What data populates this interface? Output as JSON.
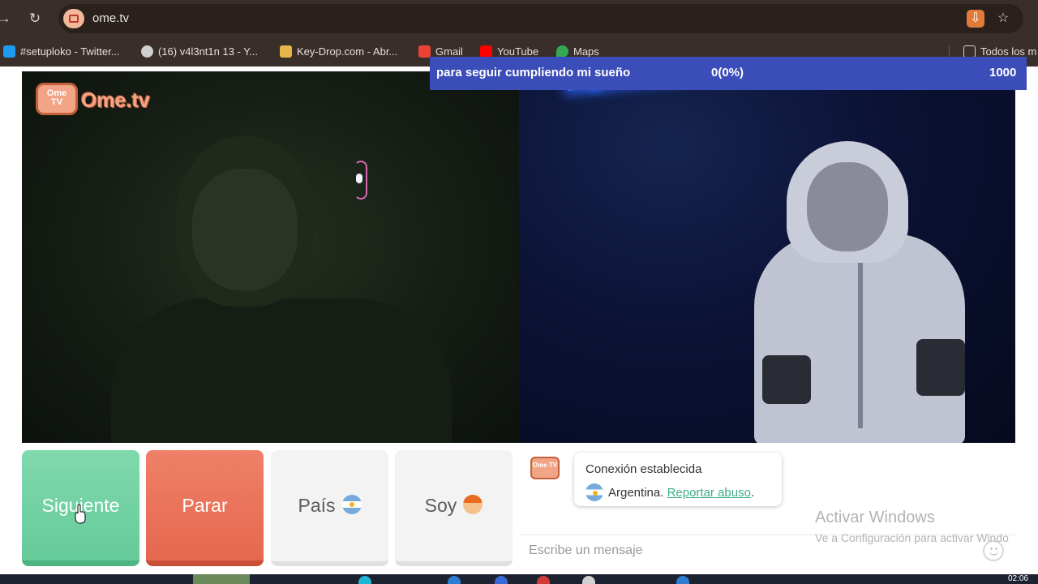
{
  "browser": {
    "url": "ome.tv",
    "nav_forward_icon": "arrow-right-icon",
    "reload_icon": "reload-icon",
    "site_icon": "video-camera-icon",
    "install_icon": "install-app-icon",
    "bookmark_star_icon": "star-icon"
  },
  "bookmarks": [
    {
      "label": "#setuploko - Twitter...",
      "icon": "twitter-icon",
      "color": "#1d9bf0"
    },
    {
      "label": "(16) v4l3nt1n 13 - Y...",
      "icon": "globe-icon",
      "color": "#cfcfcf"
    },
    {
      "label": "Key-Drop.com - Abr...",
      "icon": "gift-icon",
      "color": "#e7b64a"
    },
    {
      "label": "Gmail",
      "icon": "gmail-icon",
      "color": "#ea4335"
    },
    {
      "label": "YouTube",
      "icon": "youtube-icon",
      "color": "#ff0000"
    },
    {
      "label": "Maps",
      "icon": "maps-pin-icon",
      "color": "#34a853"
    },
    {
      "label": "Todos los m",
      "icon": "folder-icon",
      "color": "#d9d2cc"
    }
  ],
  "logo": {
    "tv_label": "Ome TV",
    "word": "Ome.tv"
  },
  "goal": {
    "message": "para seguir cumpliendo mi sueño",
    "progress": "0(0%)",
    "target": "1000",
    "color": "#3b4db8"
  },
  "controls": {
    "next_label": "Siguiente",
    "stop_label": "Parar",
    "country_label": "País",
    "gender_label": "Soy",
    "next_color": "#66ca99",
    "stop_color": "#e5684f"
  },
  "chat": {
    "status": "Conexión establecida",
    "country": "Argentina.",
    "report_link": "Reportar abuso",
    "report_suffix": ".",
    "input_placeholder": "Escribe un mensaje",
    "emoji_icon": "smiley-icon"
  },
  "watermark": {
    "line1": "Activar Windows",
    "line2": "Ve a Configuración para activar Windo"
  },
  "taskbar": {
    "clock": "02:06"
  }
}
